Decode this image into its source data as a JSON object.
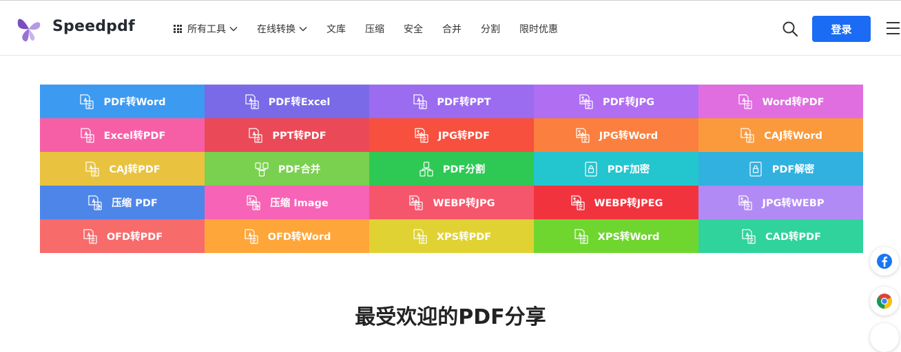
{
  "brand": {
    "name": "Speedpdf",
    "logo_icon": "butterfly-logo",
    "logo_color": "#8b5cc8"
  },
  "nav": {
    "items": [
      {
        "label": "所有工具",
        "has_grid_icon": true,
        "has_dropdown": true
      },
      {
        "label": "在线转换",
        "has_dropdown": true
      },
      {
        "label": "文库"
      },
      {
        "label": "压缩"
      },
      {
        "label": "安全"
      },
      {
        "label": "合并"
      },
      {
        "label": "分割"
      },
      {
        "label": "限时优惠"
      }
    ]
  },
  "header_actions": {
    "search_icon": "search-icon",
    "login_label": "登录",
    "login_color": "#1b6bf5",
    "menu_icon": "hamburger-menu-icon"
  },
  "tools": [
    {
      "label": "PDF转Word",
      "color": "#3d9af1",
      "icon": "pdf-to-word-icon"
    },
    {
      "label": "PDF转Excel",
      "color": "#7a6ae8",
      "icon": "pdf-to-excel-icon"
    },
    {
      "label": "PDF转PPT",
      "color": "#9b6cf0",
      "icon": "pdf-to-ppt-icon"
    },
    {
      "label": "PDF转JPG",
      "color": "#b06ef2",
      "icon": "pdf-to-jpg-icon"
    },
    {
      "label": "Word转PDF",
      "color": "#e06ee0",
      "icon": "word-to-pdf-icon"
    },
    {
      "label": "Excel转PDF",
      "color": "#f65fa6",
      "icon": "excel-to-pdf-icon"
    },
    {
      "label": "PPT转PDF",
      "color": "#ea4a58",
      "icon": "ppt-to-pdf-icon"
    },
    {
      "label": "JPG转PDF",
      "color": "#f7503e",
      "icon": "jpg-to-pdf-icon"
    },
    {
      "label": "JPG转Word",
      "color": "#fb7f3e",
      "icon": "jpg-to-word-icon"
    },
    {
      "label": "CAJ转Word",
      "color": "#fa9a3c",
      "icon": "caj-to-word-icon"
    },
    {
      "label": "CAJ转PDF",
      "color": "#e9c23f",
      "icon": "caj-to-pdf-icon"
    },
    {
      "label": "PDF合并",
      "color": "#7ad04f",
      "icon": "pdf-merge-icon"
    },
    {
      "label": "PDF分割",
      "color": "#2ec954",
      "icon": "pdf-split-icon"
    },
    {
      "label": "PDF加密",
      "color": "#23c5cf",
      "icon": "pdf-encrypt-icon"
    },
    {
      "label": "PDF解密",
      "color": "#30b1df",
      "icon": "pdf-decrypt-icon"
    },
    {
      "label": "压缩 PDF",
      "color": "#4d86e8",
      "icon": "compress-pdf-icon"
    },
    {
      "label": "压缩 Image",
      "color": "#f763b6",
      "icon": "compress-image-icon"
    },
    {
      "label": "WEBP转JPG",
      "color": "#f6566b",
      "icon": "webp-to-jpg-icon"
    },
    {
      "label": "WEBP转JPEG",
      "color": "#f1333e",
      "icon": "webp-to-jpeg-icon"
    },
    {
      "label": "JPG转WEBP",
      "color": "#b28af5",
      "icon": "jpg-to-webp-icon"
    },
    {
      "label": "OFD转PDF",
      "color": "#f76b6b",
      "icon": "ofd-to-pdf-icon"
    },
    {
      "label": "OFD转Word",
      "color": "#fea63a",
      "icon": "ofd-to-word-icon"
    },
    {
      "label": "XPS转PDF",
      "color": "#e0d233",
      "icon": "xps-to-pdf-icon"
    },
    {
      "label": "XPS转Word",
      "color": "#6fd62f",
      "icon": "xps-to-word-icon"
    },
    {
      "label": "CAD转PDF",
      "color": "#2fd39b",
      "icon": "cad-to-pdf-icon"
    }
  ],
  "section": {
    "title": "最受欢迎的PDF分享"
  },
  "floating_share": [
    {
      "icon": "facebook-icon",
      "color": "#1877f2"
    },
    {
      "icon": "chrome-icon"
    },
    {
      "icon": "share-icon"
    }
  ]
}
